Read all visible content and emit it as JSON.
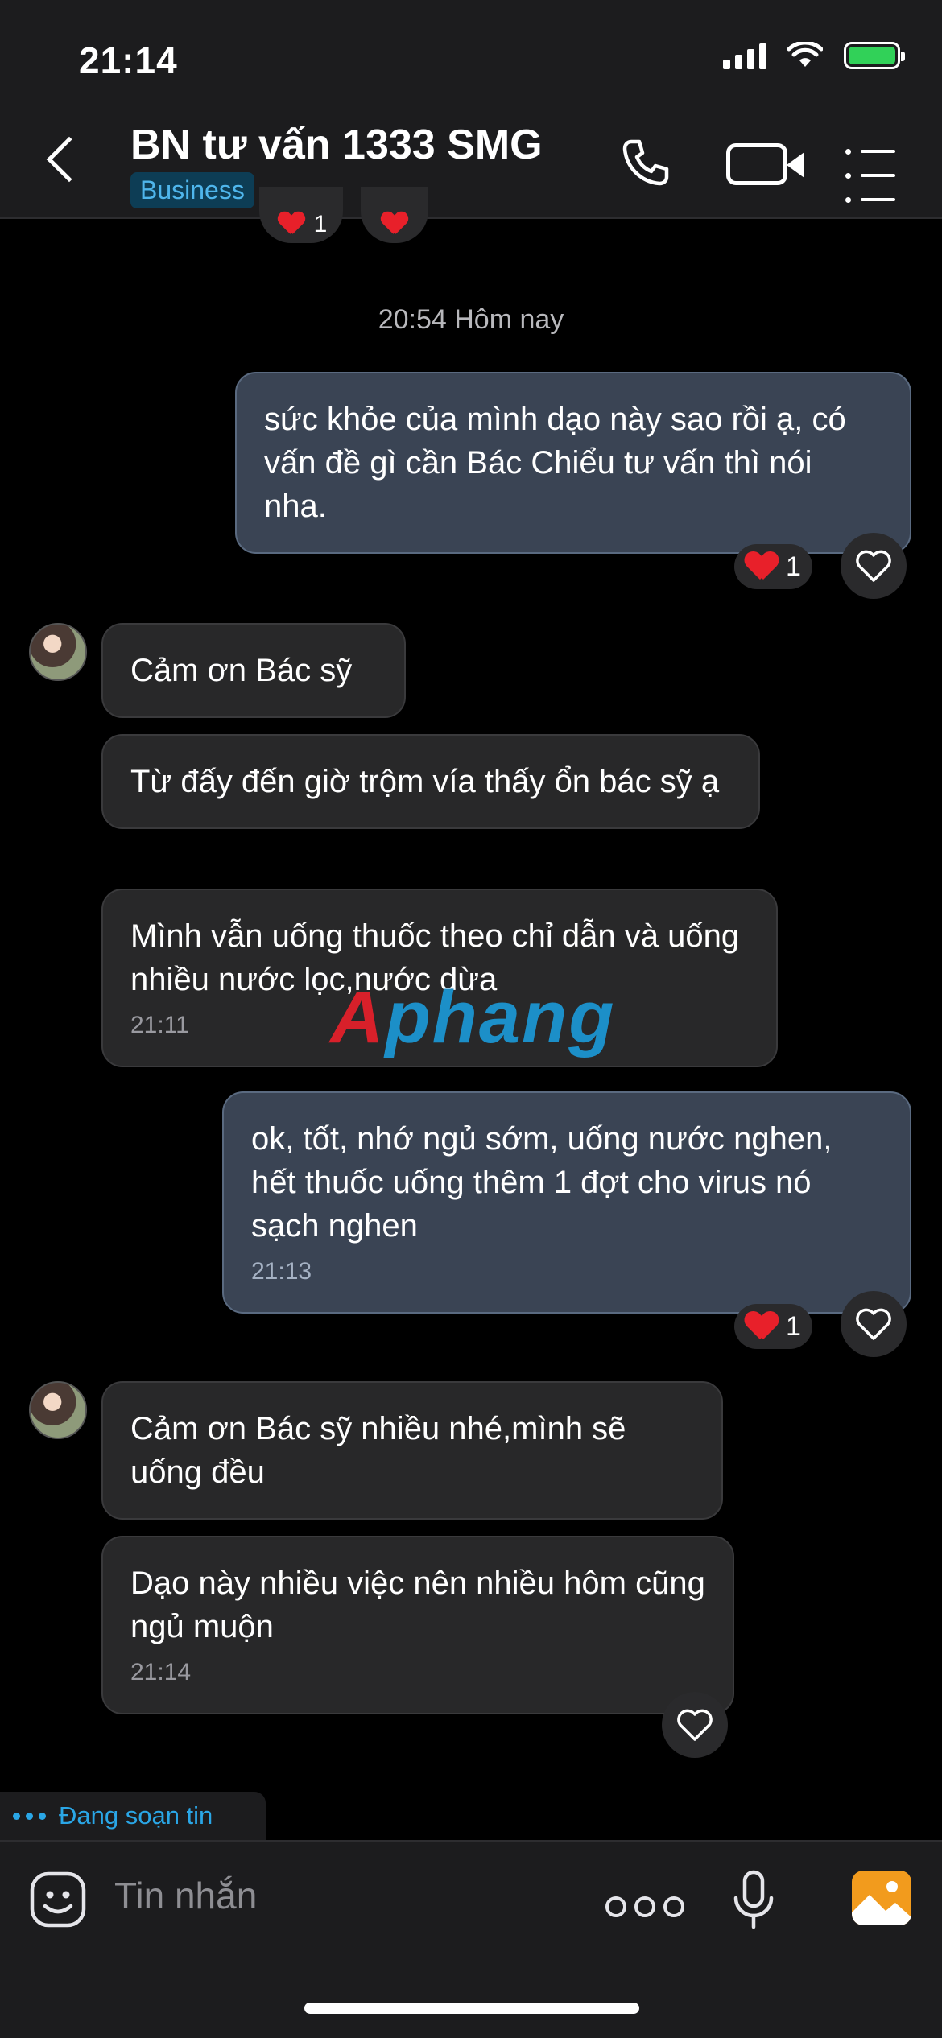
{
  "status_bar": {
    "time": "21:14"
  },
  "header": {
    "title": "BN tư vấn 1333 SMG",
    "badge": "Business"
  },
  "chat": {
    "date_separator": "20:54 Hôm nay",
    "messages": [
      {
        "direction": "out",
        "text": "sức khỏe của mình dạo này sao rồi ạ, có vấn đề gì cần Bác Chiểu tư vấn thì nói nha.",
        "reaction_count": "1"
      },
      {
        "direction": "in",
        "text": "Cảm ơn Bác sỹ"
      },
      {
        "direction": "in",
        "text": "Từ đấy đến giờ trộm vía thấy ổn bác sỹ ạ"
      },
      {
        "direction": "in",
        "text": "Mình vẫn uống thuốc theo chỉ dẫn và uống nhiều nước lọc,nước dừa",
        "time": "21:11"
      },
      {
        "direction": "out",
        "text": "ok, tốt, nhớ ngủ sớm, uống nước nghen, hết thuốc uống thêm 1 đợt cho virus nó sạch nghen",
        "time": "21:13",
        "reaction_count": "1"
      },
      {
        "direction": "in",
        "text": "Cảm ơn Bác sỹ nhiều nhé,mình sẽ uống đều"
      },
      {
        "direction": "in",
        "text": "Dạo này nhiều việc nên nhiều hôm cũng ngủ muộn",
        "time": "21:14"
      }
    ],
    "partial_reaction_count": "1"
  },
  "watermark": {
    "part1": "A",
    "part2": "phang"
  },
  "typing_indicator": "Đang soạn tin",
  "composer": {
    "placeholder": "Tin nhắn"
  },
  "colors": {
    "accent": "#2aa6e6",
    "outgoing_bubble": "#3a4454",
    "incoming_bubble": "#282829",
    "heart": "#e8202a"
  },
  "icons": [
    "back-icon",
    "phone-icon",
    "video-icon",
    "menu-icon",
    "heart-icon",
    "like-icon",
    "sticker-icon",
    "more-icon",
    "mic-icon",
    "gallery-icon"
  ]
}
